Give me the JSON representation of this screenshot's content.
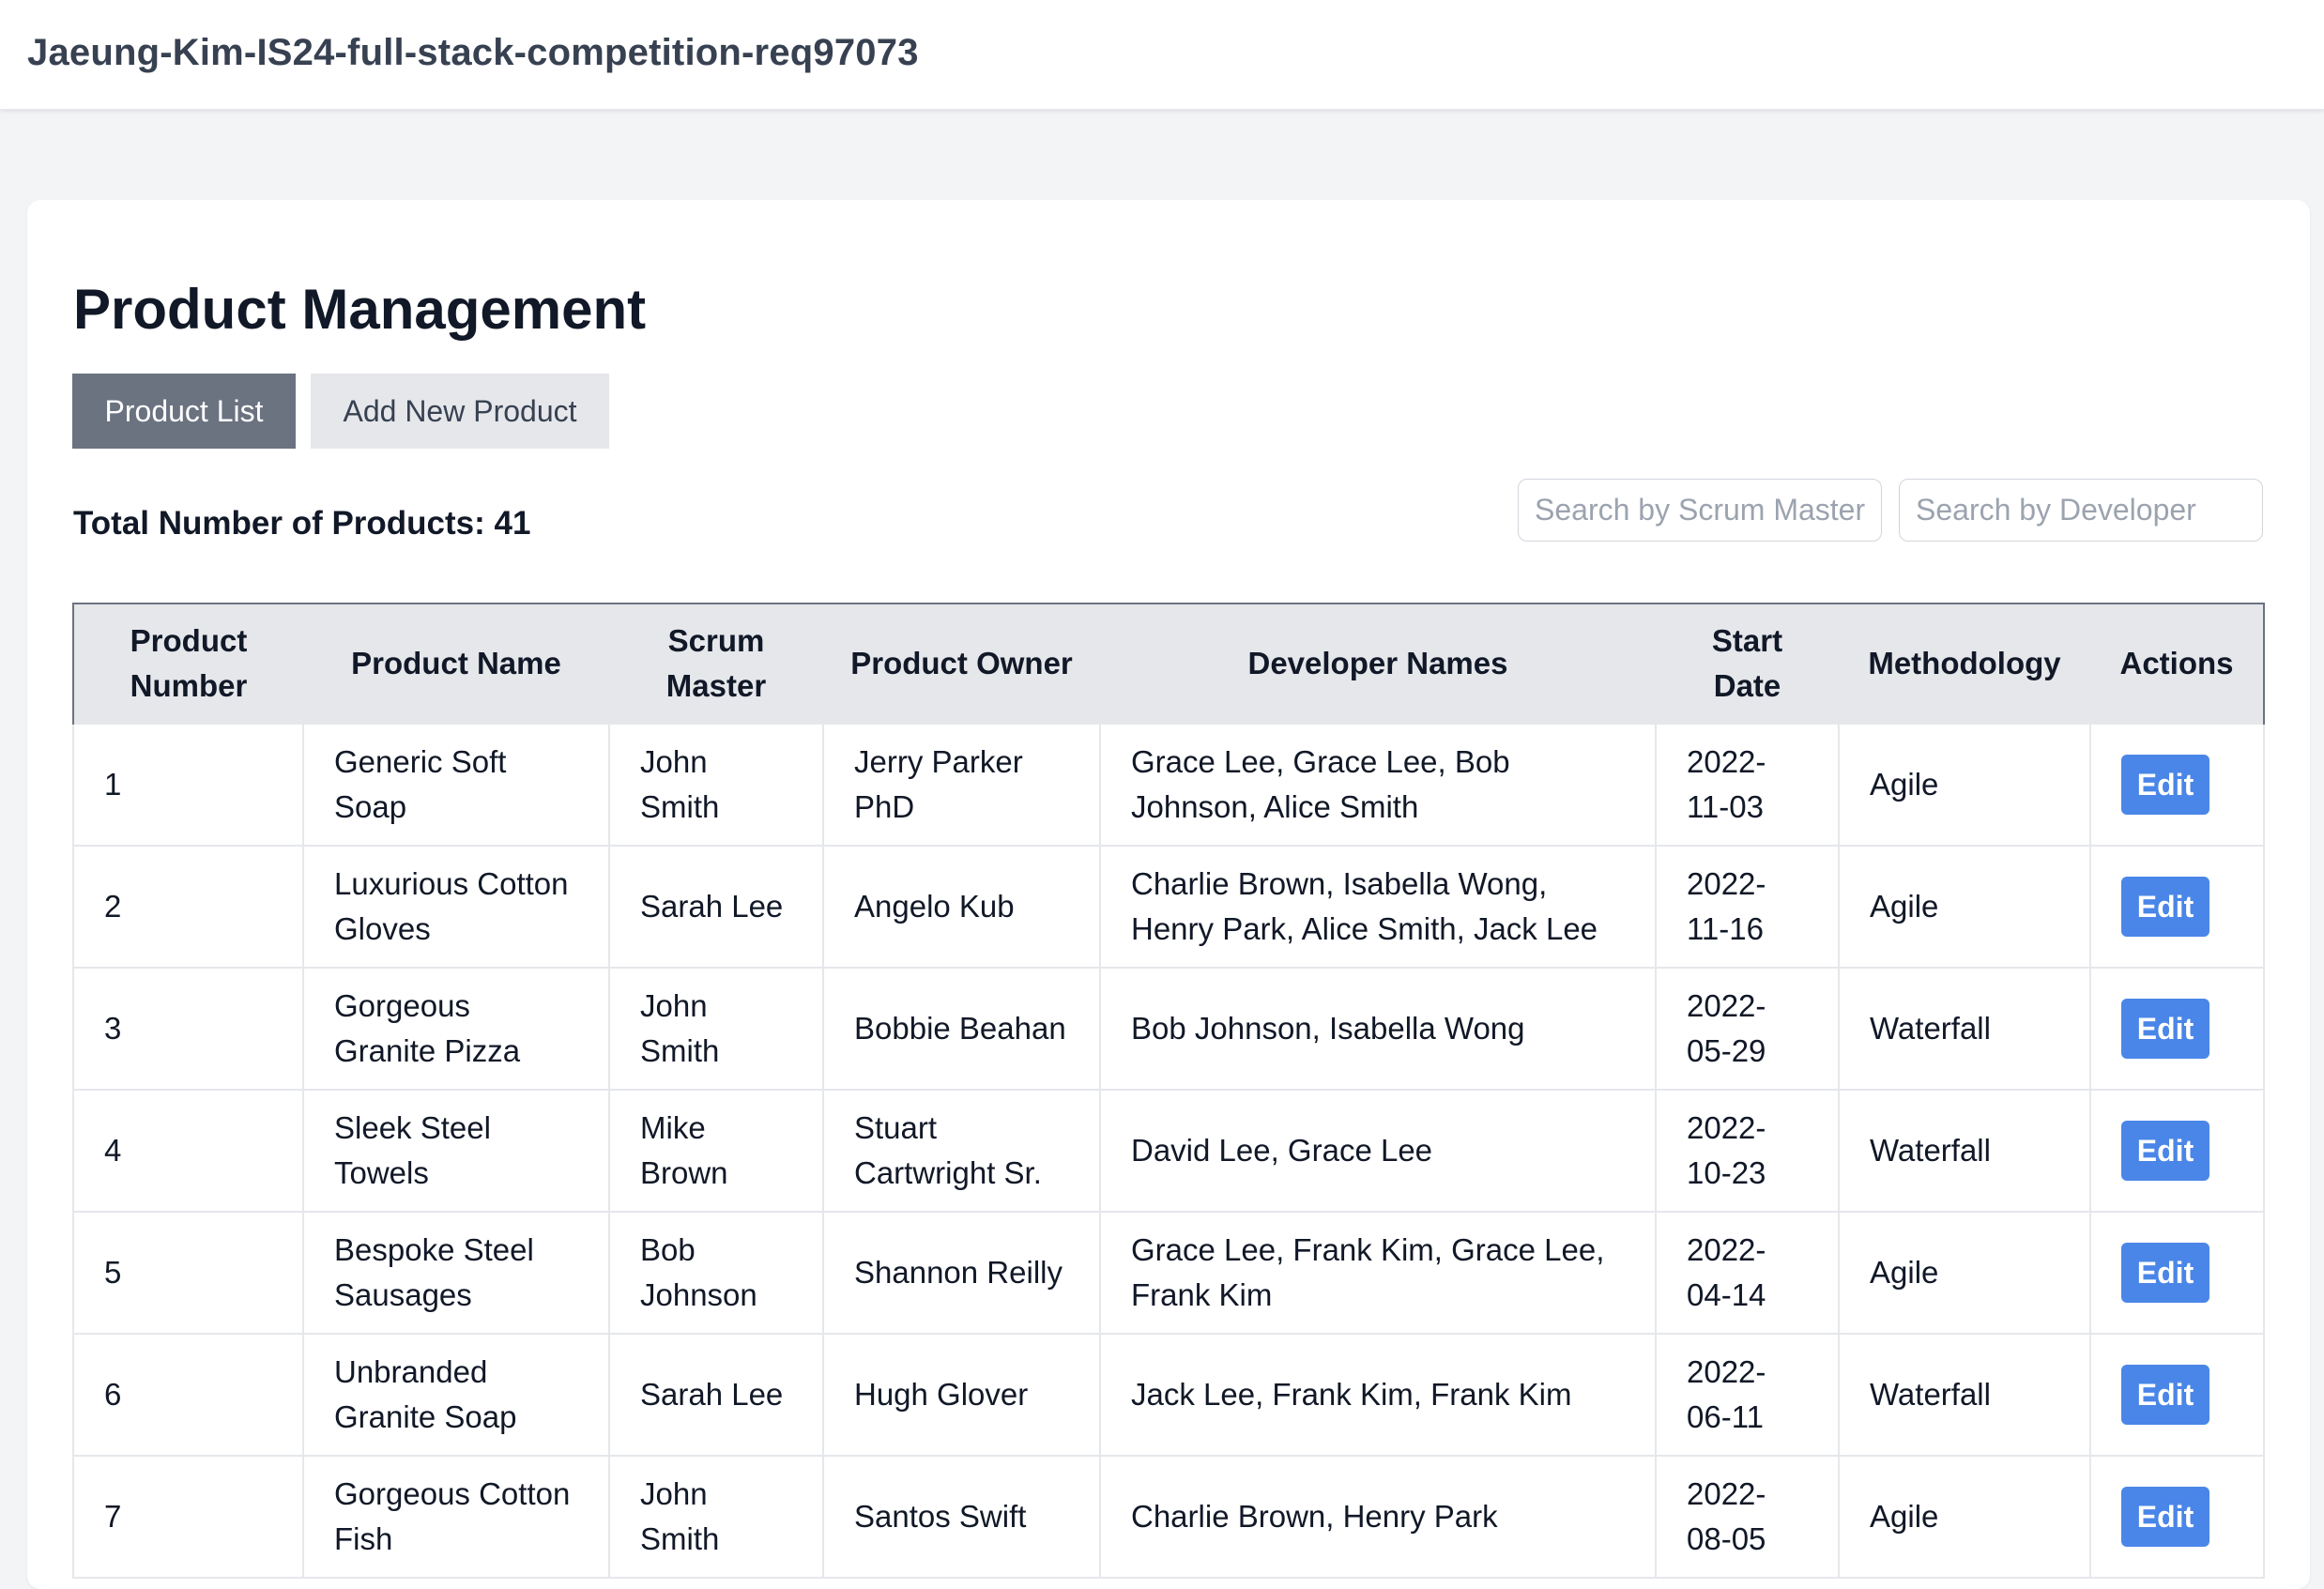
{
  "header": {
    "title": "Jaeung-Kim-IS24-full-stack-competition-req97073"
  },
  "main": {
    "title": "Product Management",
    "tabs": [
      {
        "label": "Product List",
        "active": true
      },
      {
        "label": "Add New Product",
        "active": false
      }
    ],
    "total_label": "Total Number of Products: 41",
    "search_scrum_placeholder": "Search by Scrum Master",
    "search_dev_placeholder": "Search by Developer",
    "edit_label": "Edit"
  },
  "table": {
    "columns": [
      "Product Number",
      "Product Name",
      "Scrum Master",
      "Product Owner",
      "Developer Names",
      "Start Date",
      "Methodology",
      "Actions"
    ],
    "rows": [
      [
        "1",
        "Generic Soft Soap",
        "John Smith",
        "Jerry Parker PhD",
        "Grace Lee, Grace Lee, Bob Johnson, Alice Smith",
        "2022-11-03",
        "Agile"
      ],
      [
        "2",
        "Luxurious Cotton Gloves",
        "Sarah Lee",
        "Angelo Kub",
        "Charlie Brown, Isabella Wong, Henry Park, Alice Smith, Jack Lee",
        "2022-11-16",
        "Agile"
      ],
      [
        "3",
        "Gorgeous Granite Pizza",
        "John Smith",
        "Bobbie Beahan",
        "Bob Johnson, Isabella Wong",
        "2022-05-29",
        "Waterfall"
      ],
      [
        "4",
        "Sleek Steel Towels",
        "Mike Brown",
        "Stuart Cartwright Sr.",
        "David Lee, Grace Lee",
        "2022-10-23",
        "Waterfall"
      ],
      [
        "5",
        "Bespoke Steel Sausages",
        "Bob Johnson",
        "Shannon Reilly",
        "Grace Lee, Frank Kim, Grace Lee, Frank Kim",
        "2022-04-14",
        "Agile"
      ],
      [
        "6",
        "Unbranded Granite Soap",
        "Sarah Lee",
        "Hugh Glover",
        "Jack Lee, Frank Kim, Frank Kim",
        "2022-06-11",
        "Waterfall"
      ],
      [
        "7",
        "Gorgeous Cotton Fish",
        "John Smith",
        "Santos Swift",
        "Charlie Brown, Henry Park",
        "2022-08-05",
        "Agile"
      ]
    ]
  },
  "colors": {
    "accent": "#4a86e8",
    "tab_active": "#6b7280",
    "tab_inactive": "#e5e7eb",
    "background": "#f3f4f6"
  }
}
